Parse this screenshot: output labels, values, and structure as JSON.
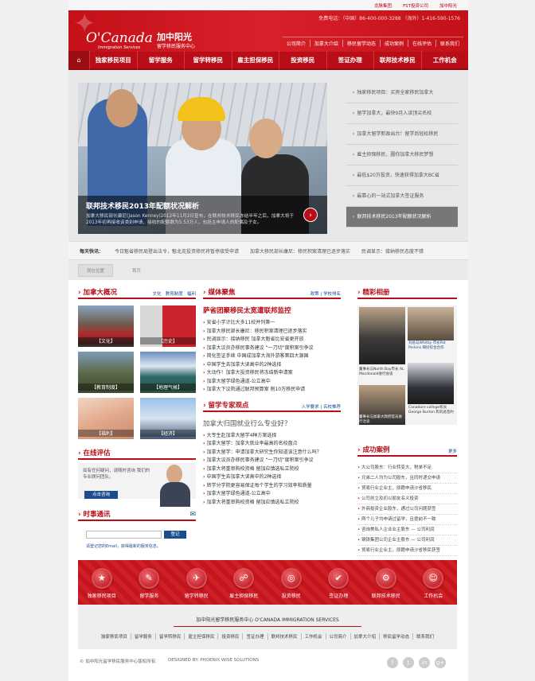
{
  "topbar": [
    "龙脉集团",
    "FST投资公司",
    "加中阳光"
  ],
  "brand": {
    "name": "O'Canada",
    "sub": "Immigration Services",
    "cn": "加中阳光",
    "cn_sub": "留学移民服务中心"
  },
  "contact": "免费电话：（中国）86-400-000-3288  （海外）1-416-590-1576",
  "topnav": [
    "公司简介",
    "加拿大介绍",
    "移民留学动态",
    "成功案例",
    "在线评估",
    "联系我们"
  ],
  "mainnav": [
    "独家移民项目",
    "留学服务",
    "留学转移民",
    "雇主担保移民",
    "投资移民",
    "签证办理",
    "联邦技术移民",
    "工作机会"
  ],
  "slider": {
    "title": "联邦技术移民2013年配额状况解析",
    "desc": "加拿大移民部长康尼(Jason Kenney)2012年11月2日宣布，在联邦技术移民冻结半年之后，加拿大将于2013年初再接收该类别申请，接收的配额数为5.53万人，包括主申请人的配偶及子女。",
    "list": [
      "独家移民项目：买房全家移民加拿大",
      "留学加拿大，最快9月入读顶尖名校",
      "加拿大留学新政出台！留学后轻松移民",
      "雇主担保移民，圆你加拿大移民梦想",
      "最低$20万投资，快速获得加拿大BC省",
      "最靠心的一站式加拿大签证服务",
      "联邦技术移民2013年配额状况解析"
    ],
    "active": 6
  },
  "ticker": {
    "label": "每天快讯：",
    "items": [
      "今日魁省移民局登出法令，魁北克投资移民将暂停接受申请",
      "加拿大移民部长康尼：移民积案清理已逐步落实",
      "民调显示：接纳移民态度不错"
    ]
  },
  "crumbs": [
    "现在位置",
    "首页"
  ],
  "about": {
    "title": "加拿大概况",
    "tabs": [
      "文化",
      "教育制度",
      "福利"
    ],
    "tiles": [
      "【文化】",
      "【历史】",
      "【教育制度】",
      "【地理气候】",
      "【福利】",
      "【经济】"
    ]
  },
  "media": {
    "title": "媒体聚焦",
    "tabs": [
      "政策",
      "学校排名"
    ],
    "headline": "萨省团聚移民太宽遭联邦监控",
    "items": [
      "安省小学计比大多11校并列第一",
      "加拿大移民部长康尼：移民积案清理已逐步落实",
      "民调显示：接纳移民 加拿大魁省比安省更开放",
      "加拿大议员办移民事务建议 “一刀切”度积案引争议",
      "简化签证手续 中国成加拿大海外游客第四大源国",
      "中国学生去加拿大读高中的2种选择",
      "大动作！加拿大投资移民将冻结新申请案",
      "加拿大留学绿色通道-公立高中",
      "加拿大下议院通过联邦预算案 削10万移民申请"
    ]
  },
  "expert": {
    "title": "留学专家观点",
    "tabs": [
      "入学要求",
      "名校推荐"
    ],
    "headline": "加拿大归国就业行么专业好？",
    "items": [
      "大专生赴加拿大留学4种方案选择",
      "加拿大留学：加拿大就业率最高的名校盘点",
      "加拿大留学：申请加拿大研究生你知道该注意什么吗？",
      "加拿大议员办移民事务建议 “一刀切”度积案引争议",
      "加拿大将重审购校资格 留加应慎选私立院校",
      "中国学生去加拿大读高中的2种选择",
      "转学分学院更容易保证每个学生的学习效率和质量",
      "加拿大留学绿色通道-公立高中",
      "加拿大将重审购校资格 留加应慎选私立院校"
    ]
  },
  "gallery": {
    "title": "精彩相册",
    "captions": [
      "刘总与Whitby 市长Pat Perkins 喝好综合合作",
      "董事长与North Bay市长 AL Macdonald进行会谈",
      "Canadore college校长George Burton 和刘总签约",
      "董事长与加拿大政府官员进行洽谈"
    ]
  },
  "success": {
    "title": "成功案例",
    "more": "更多",
    "items": [
      "大公司股东：行业转变大，税单不足",
      "兄弟二人均为公司股东，且同时递交申请",
      "贸易行业企业主，原籍申请沙省移民",
      "公司创立及初以朋友名义投资",
      "外商投资企业股东，通过公司问题获签",
      "两个儿子均申请过留学，且提前不一致",
      "咨询美私人企业业主股东 — 公司利润",
      "钢铁集团公司企业主股东 — 公司利润",
      "贸易行业企业主，原籍申请沙省移民获签"
    ]
  },
  "evaluate": {
    "title": "在线评估",
    "text": "如有任何疑问，请随时咨询 我们的专业顾问团队。",
    "button": "点击咨询"
  },
  "login": {
    "title": "时事通讯",
    "placeholder": "",
    "button": "登记",
    "note": "请登记您的Email，获得最新的服务信息。"
  },
  "iconbar": [
    {
      "label": "独家移民项目",
      "icon": "star-icon"
    },
    {
      "label": "留学服务",
      "icon": "book-icon"
    },
    {
      "label": "留学转移民",
      "icon": "plane-icon"
    },
    {
      "label": "雇主担保移民",
      "icon": "handshake-icon"
    },
    {
      "label": "投资移民",
      "icon": "globe-icon"
    },
    {
      "label": "签证办理",
      "icon": "stamp-icon"
    },
    {
      "label": "联邦技术移民",
      "icon": "gear-icon"
    },
    {
      "label": "工作机会",
      "icon": "person-icon"
    }
  ],
  "footer": {
    "title": "加中阳光留学移民服务中心   O'CANADA IMMIGRATION SERVICES",
    "links": [
      "独家移民项目",
      "留学服务",
      "留学转移民",
      "雇主担保移民",
      "投资移民",
      "签证办理",
      "联邦技术移民",
      "工作机会",
      "公司简介",
      "加拿大介绍",
      "移民留学动态",
      "联系我们"
    ],
    "copyright": "© 加中阳光留学移民服务中心版权所有.",
    "designer": "DESIGNED BY: PHOENIX WISE SOLUTIONS"
  },
  "social": [
    "f",
    "t",
    "in",
    "g+"
  ]
}
